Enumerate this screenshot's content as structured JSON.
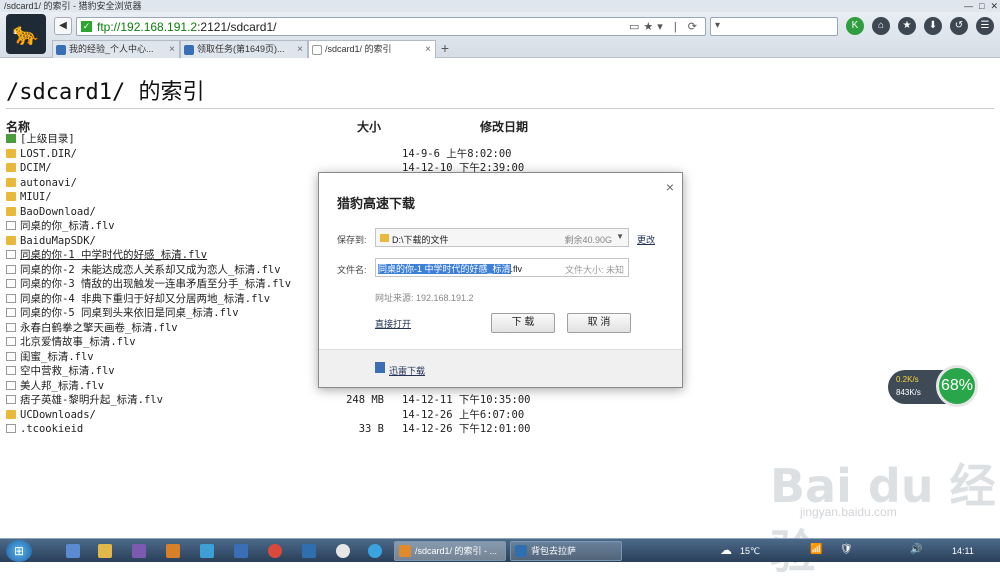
{
  "window": {
    "title": "/sdcard1/ 的索引 - 猎豹安全浏览器",
    "controls": [
      "—",
      "□",
      "✕"
    ]
  },
  "toolbar": {
    "back_label": "◀",
    "url_scheme_host": "ftp://192.168.191.2",
    "url_rest": ":2121/sdcard1/",
    "addr_icons": "▭★▾ | ⟳",
    "search_label": "▾",
    "buttons": [
      "K",
      "⌂",
      "★",
      "⬇",
      "↺",
      "☰"
    ]
  },
  "tabs": [
    {
      "label": "我的经验_个人中心...",
      "active": false
    },
    {
      "label": "领取任务(第1649页)...",
      "active": false
    },
    {
      "label": "/sdcard1/ 的索引",
      "active": true
    }
  ],
  "page": {
    "heading": "/sdcard1/ 的索引",
    "col_name": "名称",
    "col_size": "大小",
    "col_date": "修改日期",
    "rows": [
      {
        "name": "[上级目录]",
        "size": "",
        "date": "",
        "type": "up",
        "link": false
      },
      {
        "name": "LOST.DIR/",
        "size": "",
        "date": "14-9-6 上午8:02:00",
        "type": "folder",
        "link": false
      },
      {
        "name": "DCIM/",
        "size": "",
        "date": "14-12-10 下午2:39:00",
        "type": "folder",
        "link": false
      },
      {
        "name": "autonavi/",
        "size": "",
        "date": "",
        "type": "folder",
        "link": false
      },
      {
        "name": "MIUI/",
        "size": "",
        "date": "",
        "type": "folder",
        "link": false
      },
      {
        "name": "BaoDownload/",
        "size": "",
        "date": "",
        "type": "folder",
        "link": false
      },
      {
        "name": "同桌的你_标清.flv",
        "size": "",
        "date": "",
        "type": "file",
        "link": false
      },
      {
        "name": "BaiduMapSDK/",
        "size": "",
        "date": "",
        "type": "folder",
        "link": false
      },
      {
        "name": "同桌的你-1 中学时代的好感_标清.flv",
        "size": "",
        "date": "",
        "type": "file",
        "link": true
      },
      {
        "name": "同桌的你-2 未能达成恋人关系却又成为恋人_标清.flv",
        "size": "",
        "date": "",
        "type": "file",
        "link": false
      },
      {
        "name": "同桌的你-3 情敌的出现触发一连串矛盾至分手_标清.flv",
        "size": "",
        "date": "",
        "type": "file",
        "link": false
      },
      {
        "name": "同桌的你-4 非典下重归于好却又分居两地_标清.flv",
        "size": "",
        "date": "",
        "type": "file",
        "link": false
      },
      {
        "name": "同桌的你-5 同桌到头来依旧是同桌_标清.flv",
        "size": "",
        "date": "",
        "type": "file",
        "link": false
      },
      {
        "name": "永春白鹤拳之擎天画卷_标清.flv",
        "size": "",
        "date": "",
        "type": "file",
        "link": false
      },
      {
        "name": "北京爱情故事_标清.flv",
        "size": "",
        "date": "",
        "type": "file",
        "link": false
      },
      {
        "name": "闺蜜_标清.flv",
        "size": "",
        "date": "",
        "type": "file",
        "link": false
      },
      {
        "name": "空中营救_标清.flv",
        "size": "",
        "date": "",
        "type": "file",
        "link": false
      },
      {
        "name": "美人邦_标清.flv",
        "size": "",
        "date": "",
        "type": "file",
        "link": false
      },
      {
        "name": "痞子英雄-黎明升起_标清.flv",
        "size": "248 MB",
        "date": "14-12-11 下午10:35:00",
        "type": "file",
        "link": false
      },
      {
        "name": "UCDownloads/",
        "size": "",
        "date": "14-12-26 上午6:07:00",
        "type": "folder",
        "link": false
      },
      {
        "name": ".tcookieid",
        "size": "33 B",
        "date": "14-12-26 下午12:01:00",
        "type": "file",
        "link": false
      }
    ]
  },
  "dialog": {
    "title": "猎豹高速下载",
    "close": "×",
    "save_label": "保存到:",
    "save_path": "D:\\下载的文件",
    "free_space": "剩余40.90G",
    "change_label": "更改",
    "filename_label": "文件名:",
    "filename_selected": "同桌的你-1 中学时代的好感_标清",
    "filename_ext": ".flv",
    "filesize": "文件大小: 未知",
    "source": "网址来源: 192.168.191.2",
    "direct_open": "直接打开",
    "download_btn": "下 载",
    "cancel_btn": "取 消",
    "thunder_label": "迅雷下载"
  },
  "netwidget": {
    "up": "0.2K/s",
    "down": "843K/s",
    "percent": "68%"
  },
  "watermark": {
    "main": "Bai du 经验",
    "sub": "jingyan.baidu.com"
  },
  "taskbar": {
    "tasks": [
      {
        "label": "/sdcard1/ 的索引 - ...",
        "active": true
      },
      {
        "label": "背包去拉萨",
        "active": false
      }
    ],
    "weather": "15℃",
    "time": "14:11"
  }
}
